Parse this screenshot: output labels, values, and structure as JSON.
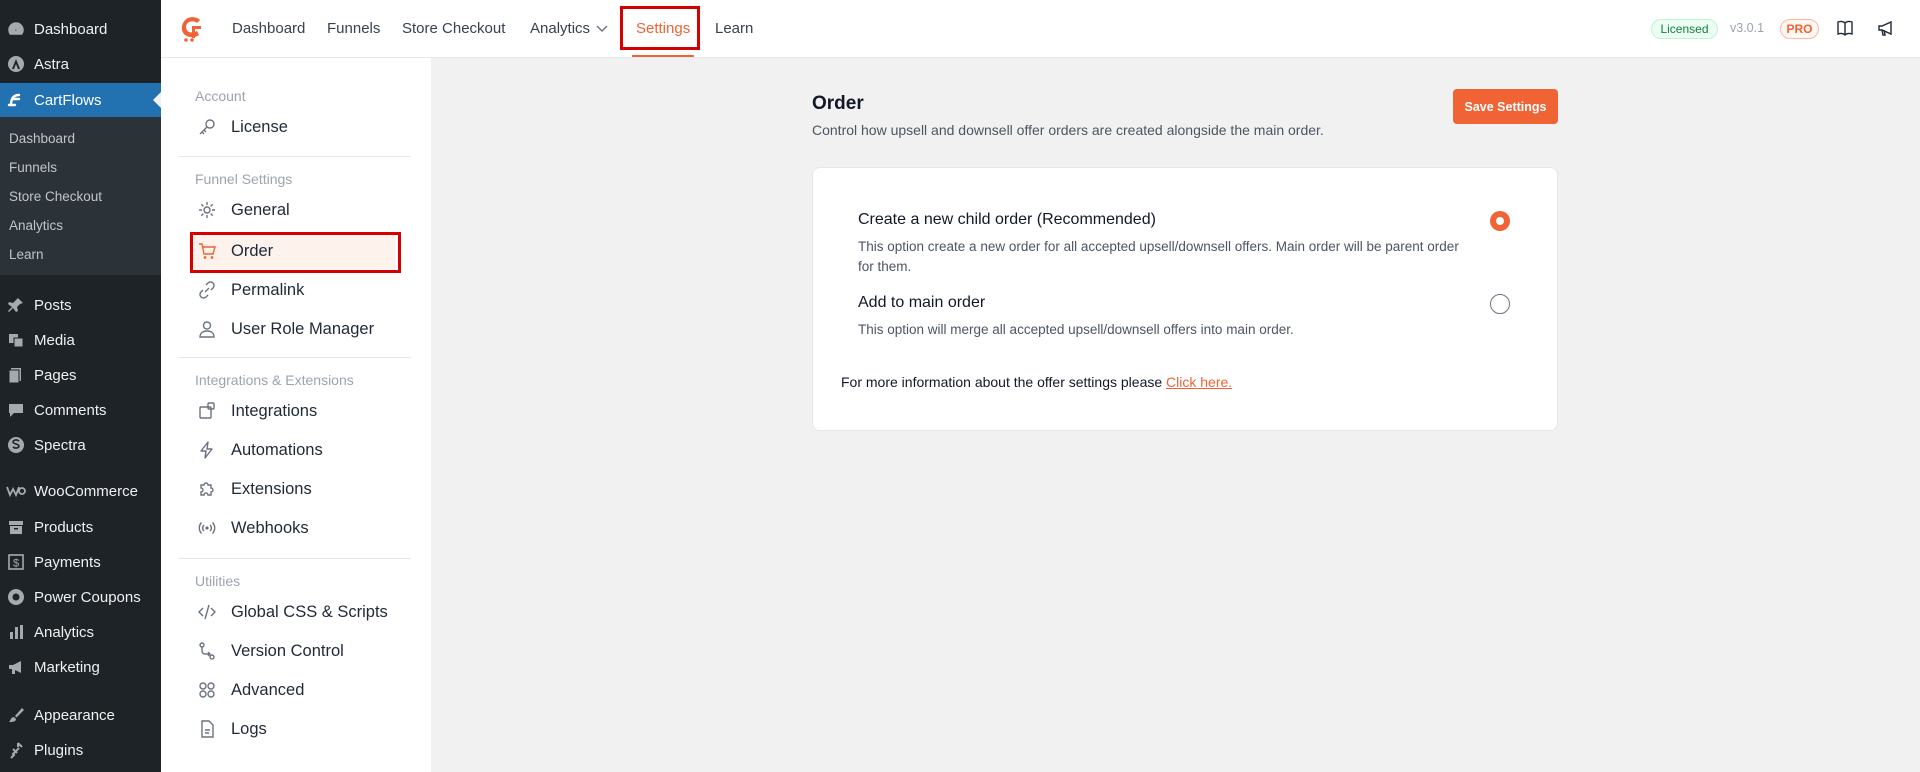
{
  "wp_sidebar": {
    "items": [
      {
        "label": "Dashboard",
        "icon": "dashboard-icon"
      },
      {
        "label": "Astra",
        "icon": "astra-icon"
      },
      {
        "label": "CartFlows",
        "icon": "cartflows-icon"
      },
      {
        "label": "Posts",
        "icon": "pin-icon"
      },
      {
        "label": "Media",
        "icon": "media-icon"
      },
      {
        "label": "Pages",
        "icon": "pages-icon"
      },
      {
        "label": "Comments",
        "icon": "comment-icon"
      },
      {
        "label": "Spectra",
        "icon": "spectra-icon"
      },
      {
        "label": "WooCommerce",
        "icon": "woocommerce-icon"
      },
      {
        "label": "Products",
        "icon": "archive-icon"
      },
      {
        "label": "Payments",
        "icon": "dollar-icon"
      },
      {
        "label": "Power Coupons",
        "icon": "coupon-icon"
      },
      {
        "label": "Analytics",
        "icon": "chart-bar-icon"
      },
      {
        "label": "Marketing",
        "icon": "megaphone-icon"
      },
      {
        "label": "Appearance",
        "icon": "brush-icon"
      },
      {
        "label": "Plugins",
        "icon": "plug-icon"
      }
    ],
    "submenu": [
      "Dashboard",
      "Funnels",
      "Store Checkout",
      "Analytics",
      "Learn"
    ]
  },
  "topbar": {
    "nav": [
      "Dashboard",
      "Funnels",
      "Store Checkout",
      "Analytics",
      "Settings",
      "Learn"
    ],
    "status": "Licensed",
    "version": "v3.0.1",
    "pro": "PRO"
  },
  "settings_nav": {
    "groups": [
      "Account",
      "Funnel Settings",
      "Integrations & Extensions",
      "Utilities"
    ],
    "items": [
      {
        "label": "License",
        "icon": "key-icon"
      },
      {
        "label": "General",
        "icon": "gear-icon"
      },
      {
        "label": "Order",
        "icon": "cart-icon"
      },
      {
        "label": "Permalink",
        "icon": "link-icon"
      },
      {
        "label": "User Role Manager",
        "icon": "user-icon"
      },
      {
        "label": "Integrations",
        "icon": "integrations-icon"
      },
      {
        "label": "Automations",
        "icon": "bolt-icon"
      },
      {
        "label": "Extensions",
        "icon": "puzzle-icon"
      },
      {
        "label": "Webhooks",
        "icon": "broadcast-icon"
      },
      {
        "label": "Global CSS & Scripts",
        "icon": "code-icon"
      },
      {
        "label": "Version Control",
        "icon": "git-icon"
      },
      {
        "label": "Advanced",
        "icon": "grid-icon"
      },
      {
        "label": "Logs",
        "icon": "file-icon"
      }
    ]
  },
  "main": {
    "title": "Order",
    "description": "Control how upsell and downsell offer orders are created alongside the main order.",
    "save_label": "Save Settings",
    "options": [
      {
        "title": "Create a new child order (Recommended)",
        "description": "This option create a new order for all accepted upsell/downsell offers. Main order will be parent order for them.",
        "selected": true
      },
      {
        "title": "Add to main order",
        "description": "This option will merge all accepted upsell/downsell offers into main order.",
        "selected": false
      }
    ],
    "info_text": "For more information about the offer settings please",
    "info_link": "Click here."
  },
  "colors": {
    "accent": "#f06335",
    "wp_sidebar": "#1d2327",
    "wp_active": "#2271b1",
    "highlight": "#d50000"
  }
}
